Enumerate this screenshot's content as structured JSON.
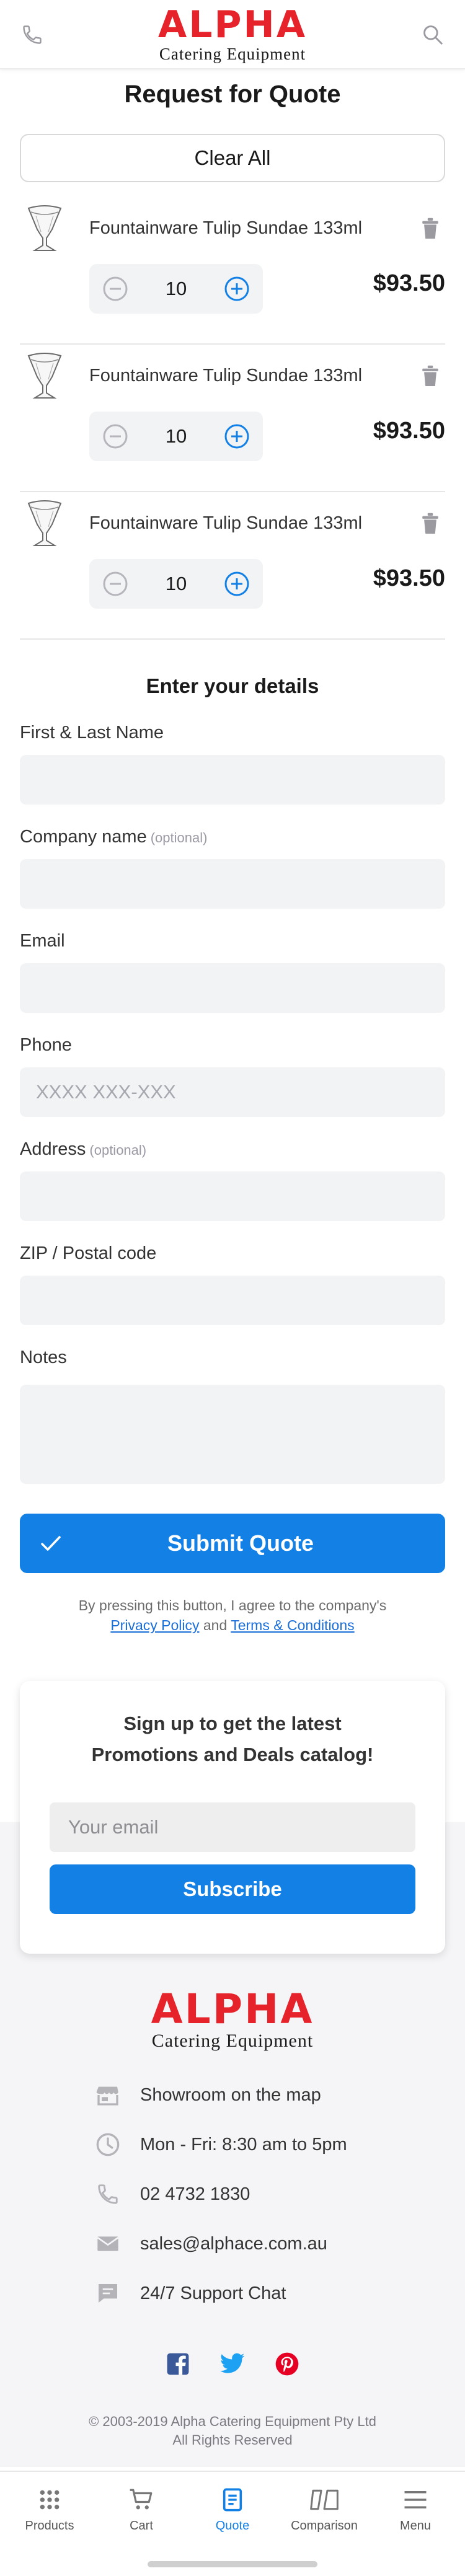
{
  "header": {
    "logo_text": "ALPHA",
    "logo_subtext": "Catering Equipment"
  },
  "page": {
    "title": "Request for Quote",
    "clear_all": "Clear All"
  },
  "cart": {
    "items": [
      {
        "name": "Fountainware Tulip Sundae 133ml",
        "quantity": "10",
        "price": "$93.50"
      },
      {
        "name": "Fountainware Tulip Sundae 133ml",
        "quantity": "10",
        "price": "$93.50"
      },
      {
        "name": "Fountainware Tulip Sundae 133ml",
        "quantity": "10",
        "price": "$93.50"
      }
    ]
  },
  "form": {
    "title": "Enter your details",
    "optional_tag": "(optional)",
    "fields": {
      "name": {
        "label": "First & Last Name",
        "value": "",
        "placeholder": ""
      },
      "company": {
        "label": "Company name",
        "value": "",
        "placeholder": ""
      },
      "email": {
        "label": "Email",
        "value": "",
        "placeholder": ""
      },
      "phone": {
        "label": "Phone",
        "value": "",
        "placeholder": "XXXX XXX-XXX"
      },
      "address": {
        "label": "Address",
        "value": "",
        "placeholder": ""
      },
      "zip": {
        "label": "ZIP / Postal code",
        "value": "",
        "placeholder": ""
      },
      "notes": {
        "label": "Notes",
        "value": "",
        "placeholder": ""
      }
    },
    "submit_label": "Submit Quote",
    "disclaimer_text": "By pressing this button, I agree to the company's",
    "privacy_link": "Privacy Policy",
    "and_text": "and",
    "terms_link": "Terms & Conditions"
  },
  "newsletter": {
    "title_line1": "Sign up to get the latest",
    "title_line2": "Promotions and Deals catalog!",
    "email_placeholder": "Your email",
    "button_label": "Subscribe"
  },
  "footer": {
    "logo_text": "ALPHA",
    "logo_subtext": "Catering Equipment",
    "contacts": [
      {
        "icon": "store-icon",
        "text": "Showroom on the map"
      },
      {
        "icon": "clock-icon",
        "text": "Mon - Fri: 8:30 am to 5pm"
      },
      {
        "icon": "phone-icon",
        "text": "02 4732 1830"
      },
      {
        "icon": "mail-icon",
        "text": "sales@alphace.com.au"
      },
      {
        "icon": "chat-icon",
        "text": "24/7 Support Chat"
      }
    ],
    "copyright_line1": "© 2003-2019 Alpha Catering Equipment Pty Ltd",
    "copyright_line2": "All Rights Reserved"
  },
  "bottom_nav": {
    "items": [
      {
        "label": "Products",
        "icon": "grid-icon",
        "active": false
      },
      {
        "label": "Cart",
        "icon": "cart-icon",
        "active": false
      },
      {
        "label": "Quote",
        "icon": "quote-icon",
        "active": true
      },
      {
        "label": "Comparison",
        "icon": "compare-icon",
        "active": false
      },
      {
        "label": "Menu",
        "icon": "menu-icon",
        "active": false
      }
    ]
  },
  "colors": {
    "brand_red": "#e6232a",
    "accent_blue": "#1380e6",
    "input_bg": "#f2f3f5"
  }
}
